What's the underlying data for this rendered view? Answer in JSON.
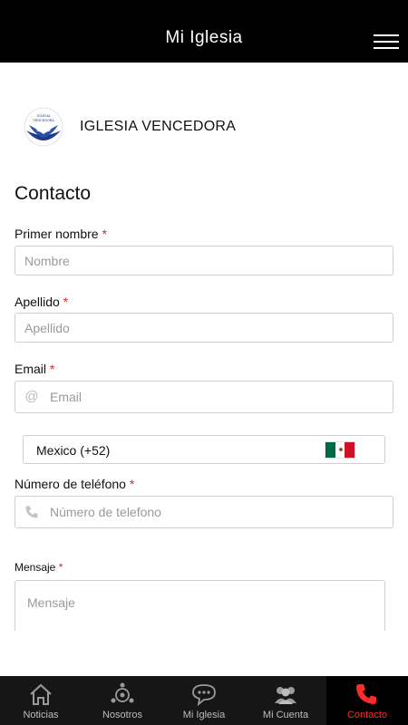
{
  "header": {
    "title": "Mi Iglesia",
    "menu_icon": "hamburger-menu-icon"
  },
  "brand": {
    "name": "IGLESIA VENCEDORA",
    "logo": "church-logo-icon",
    "logo_text": "IGLESIA VENCEDORA"
  },
  "form": {
    "title": "Contacto",
    "required_mark": "*",
    "first_name": {
      "label": "Primer nombre",
      "placeholder": "Nombre",
      "value": ""
    },
    "last_name": {
      "label": "Apellido",
      "placeholder": "Apellido",
      "value": ""
    },
    "email": {
      "label": "Email",
      "placeholder": "Email",
      "value": "",
      "icon": "at-sign-icon"
    },
    "country": {
      "selected": "Mexico (+52)",
      "flag": "mexico-flag-icon"
    },
    "phone": {
      "label": "Número de teléfono",
      "placeholder": "Número de telefono",
      "value": "",
      "icon": "phone-icon"
    },
    "message": {
      "label": "Mensaje",
      "placeholder": "Mensaje",
      "value": ""
    }
  },
  "tabs": [
    {
      "label": "Noticias",
      "icon": "home-icon",
      "active": false
    },
    {
      "label": "Nosotros",
      "icon": "people-network-icon",
      "active": false
    },
    {
      "label": "Mi Iglesia",
      "icon": "chat-bubble-icon",
      "active": false
    },
    {
      "label": "Mi Cuenta",
      "icon": "user-group-icon",
      "active": false
    },
    {
      "label": "Contacto",
      "icon": "phone-icon",
      "active": true
    }
  ],
  "colors": {
    "accent": "#ff2a2a",
    "required": "#d62b2b",
    "topbar": "#000000",
    "tabbar": "#161616",
    "logo_blue": "#1f3a8a",
    "flag_green": "#006847",
    "flag_red": "#ce1126"
  }
}
